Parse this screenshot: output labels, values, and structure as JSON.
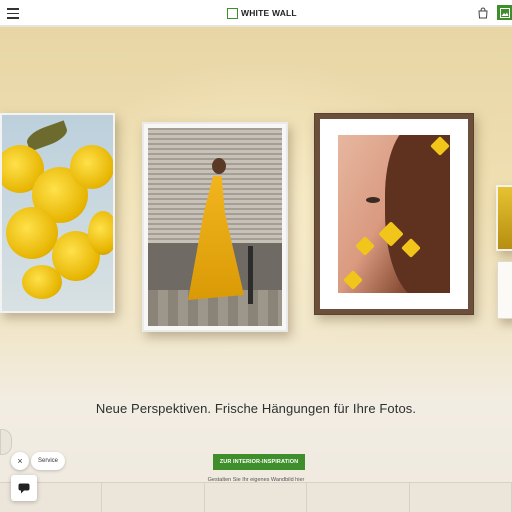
{
  "header": {
    "logo_text": "WHITE WALL",
    "menu_icon": "hamburger-menu-icon",
    "cart_icon": "shopping-bag-icon",
    "gallery_icon": "image-gallery-icon",
    "brand_color": "#3e8e2b"
  },
  "hero": {
    "headline": "Neue Perspektiven. Frische Hängungen für Ihre Fotos.",
    "cta_label": "ZUR INTERIOR-INSPIRATION",
    "subline": "Gestalten Sie Ihr eigenes Wandbild hier"
  },
  "service": {
    "close_glyph": "×",
    "label": "Service",
    "chat_icon": "chat-bubble-icon"
  }
}
